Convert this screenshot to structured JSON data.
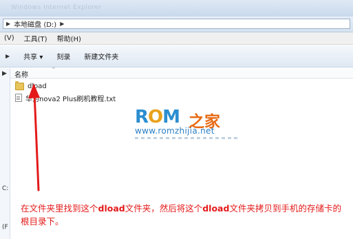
{
  "window": {
    "title": "Windows Internet Explorer"
  },
  "address_bar": {
    "path_segments": [
      "本地磁盘 (D:)"
    ],
    "prefix_icon": "nav-arrow-icon"
  },
  "menu": {
    "items": [
      "(V)",
      "工具(T)",
      "帮助(H)"
    ]
  },
  "toolbar": {
    "items": [
      {
        "label": "共享 ▾"
      },
      {
        "label": "刻录"
      },
      {
        "label": "新建文件夹"
      }
    ]
  },
  "columns": {
    "name": "名称"
  },
  "files": [
    {
      "name": "dload",
      "icon": "folder-icon"
    },
    {
      "name": "华为nova2 Plus刷机教程.txt",
      "icon": "text-file-icon"
    }
  ],
  "watermark": {
    "logo_text_a": "R",
    "logo_text_o": "O",
    "logo_text_b": "M",
    "logo_text_cn": "之家",
    "url": "www.romzhijia.net"
  },
  "left_pane": {
    "c_label": "C:",
    "f_label": "(F"
  },
  "instruction": {
    "part1": "在文件夹里找到这个",
    "bold1": "dload",
    "part2": "文件夹，然后将这个",
    "bold2": "dload",
    "part3": "文件夹拷贝到手机的存储卡的根目录下。"
  },
  "colors": {
    "annotation_red": "#e41a1a",
    "accent_blue": "#2b8ed0",
    "accent_orange": "#e86b15"
  }
}
